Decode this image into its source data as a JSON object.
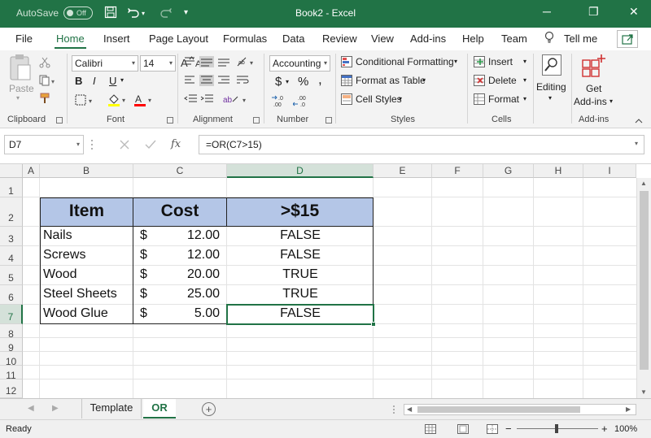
{
  "titlebar": {
    "autosave_label": "AutoSave",
    "autosave_state": "Off",
    "title": "Book2  -  Excel",
    "minimize_glyph": "─",
    "restore_glyph": "❐",
    "close_glyph": "✕"
  },
  "tabs": [
    {
      "label": "File"
    },
    {
      "label": "Home"
    },
    {
      "label": "Insert"
    },
    {
      "label": "Page Layout"
    },
    {
      "label": "Formulas"
    },
    {
      "label": "Data"
    },
    {
      "label": "Review"
    },
    {
      "label": "View"
    },
    {
      "label": "Add-ins"
    },
    {
      "label": "Help"
    },
    {
      "label": "Team"
    }
  ],
  "tell_me": "Tell me",
  "ribbon": {
    "clipboard": {
      "label": "Clipboard",
      "paste": "Paste"
    },
    "font": {
      "label": "Font",
      "name": "Calibri",
      "size": "14",
      "bold": "B",
      "italic": "I",
      "underline": "U"
    },
    "alignment": {
      "label": "Alignment"
    },
    "number": {
      "label": "Number",
      "format": "Accounting",
      "currency": "$",
      "percent": "%",
      "comma": ","
    },
    "styles": {
      "label": "Styles",
      "conditional": "Conditional Formatting",
      "format_table": "Format as Table",
      "cell_styles": "Cell Styles"
    },
    "cells": {
      "label": "Cells",
      "insert": "Insert",
      "delete": "Delete",
      "format": "Format"
    },
    "editing": {
      "label": "Editing"
    },
    "addins": {
      "label": "Add-ins",
      "get": "Get",
      "addins": "Add-ins"
    }
  },
  "formula_bar": {
    "name_box": "D7",
    "formula": "=OR(C7>15)",
    "fx": "fx"
  },
  "columns": [
    "A",
    "B",
    "C",
    "D",
    "E",
    "F",
    "G",
    "H",
    "I"
  ],
  "rows": [
    "1",
    "2",
    "3",
    "4",
    "5",
    "6",
    "7",
    "8",
    "9",
    "10",
    "11",
    "12"
  ],
  "table": {
    "headers": [
      "Item",
      "Cost",
      ">$15"
    ],
    "rows": [
      {
        "item": "Nails",
        "currency": "$",
        "cost": "12.00",
        "result": "FALSE"
      },
      {
        "item": "Screws",
        "currency": "$",
        "cost": "12.00",
        "result": "FALSE"
      },
      {
        "item": "Wood",
        "currency": "$",
        "cost": "20.00",
        "result": "TRUE"
      },
      {
        "item": "Steel Sheets",
        "currency": "$",
        "cost": "25.00",
        "result": "TRUE"
      },
      {
        "item": "Wood Glue",
        "currency": "$",
        "cost": "5.00",
        "result": "FALSE"
      }
    ]
  },
  "sheets": [
    {
      "label": "Template"
    },
    {
      "label": "OR"
    }
  ],
  "add_sheet": "+",
  "status": {
    "ready": "Ready",
    "zoom": "100%",
    "zoom_out": "−",
    "zoom_in": "+"
  },
  "colors": {
    "accent": "#217346",
    "header_fill": "#b4c6e7"
  }
}
